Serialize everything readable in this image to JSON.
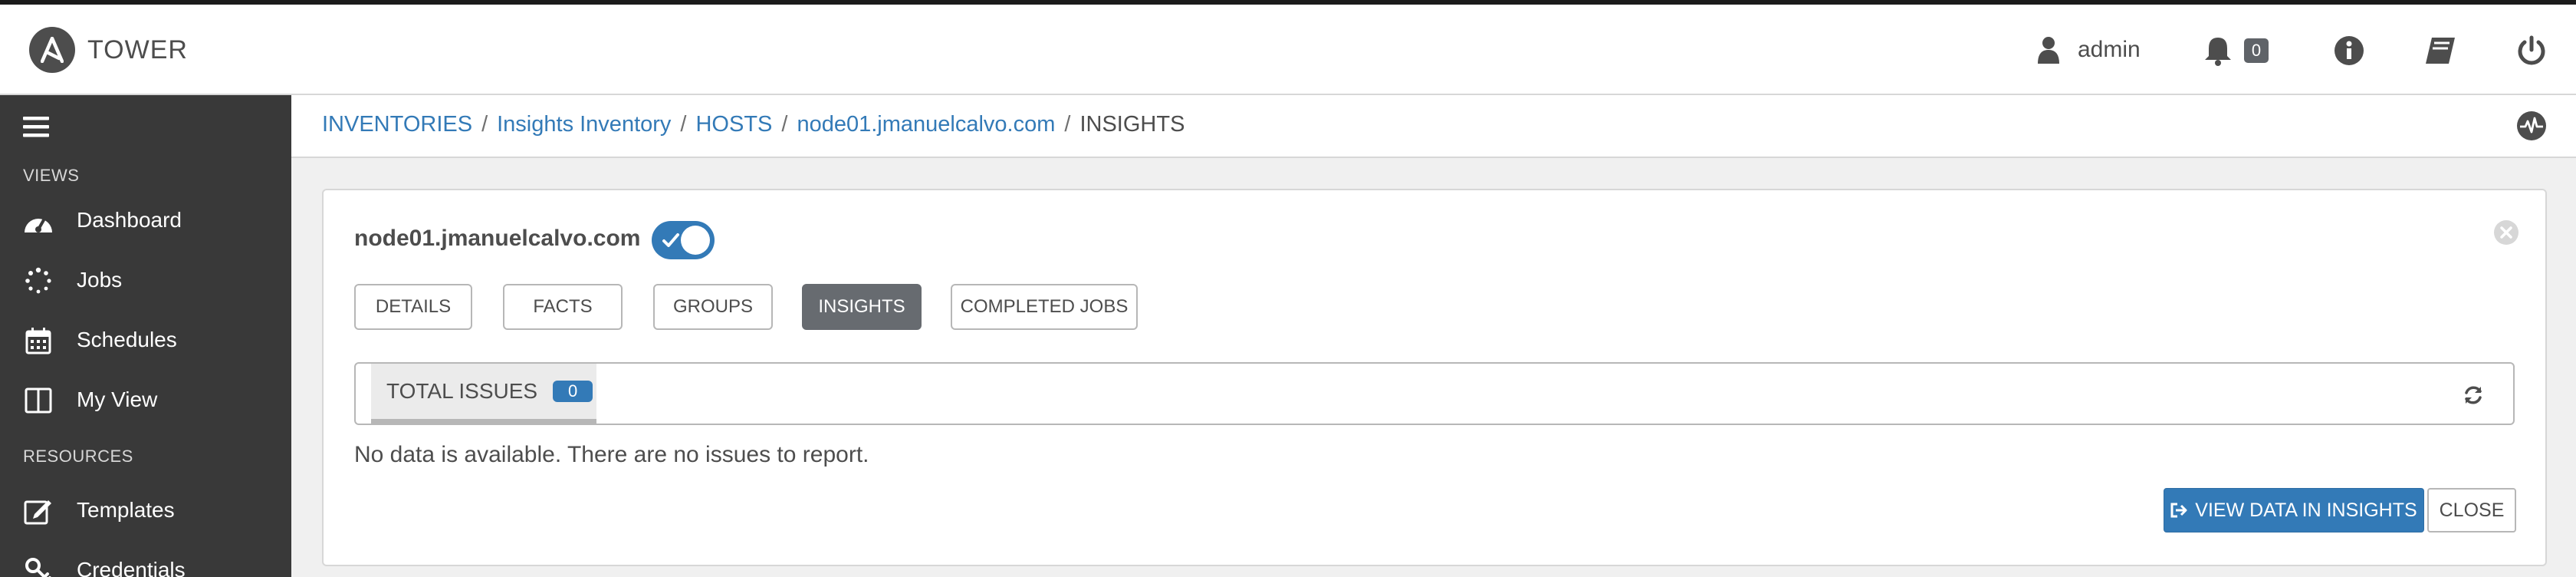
{
  "app": {
    "brand": "TOWER"
  },
  "header": {
    "user": "admin",
    "notifications_count": "0"
  },
  "sidebar": {
    "sections": {
      "views": "VIEWS",
      "resources": "RESOURCES"
    },
    "items": [
      {
        "label": "Dashboard",
        "icon": "dashboard-icon"
      },
      {
        "label": "Jobs",
        "icon": "jobs-spinner-icon"
      },
      {
        "label": "Schedules",
        "icon": "calendar-icon"
      },
      {
        "label": "My View",
        "icon": "columns-icon"
      },
      {
        "label": "Templates",
        "icon": "edit-icon"
      },
      {
        "label": "Credentials",
        "icon": "key-icon"
      }
    ]
  },
  "breadcrumb": {
    "inventories": "INVENTORIES",
    "inventory": "Insights Inventory",
    "hosts": "HOSTS",
    "host": "node01.jmanuelcalvo.com",
    "current": "INSIGHTS"
  },
  "host_panel": {
    "title": "node01.jmanuelcalvo.com",
    "enabled": true,
    "tabs": [
      "DETAILS",
      "FACTS",
      "GROUPS",
      "INSIGHTS",
      "COMPLETED JOBS"
    ],
    "active_tab": "INSIGHTS",
    "total_issues_label": "TOTAL ISSUES",
    "total_issues_count": "0",
    "no_data_message": "No data is available. There are no issues to report.",
    "view_button": "VIEW DATA IN INSIGHTS",
    "close_button": "CLOSE"
  },
  "colors": {
    "accent": "#337ab7",
    "sidebar": "#393939",
    "active_tab": "#676b70"
  }
}
